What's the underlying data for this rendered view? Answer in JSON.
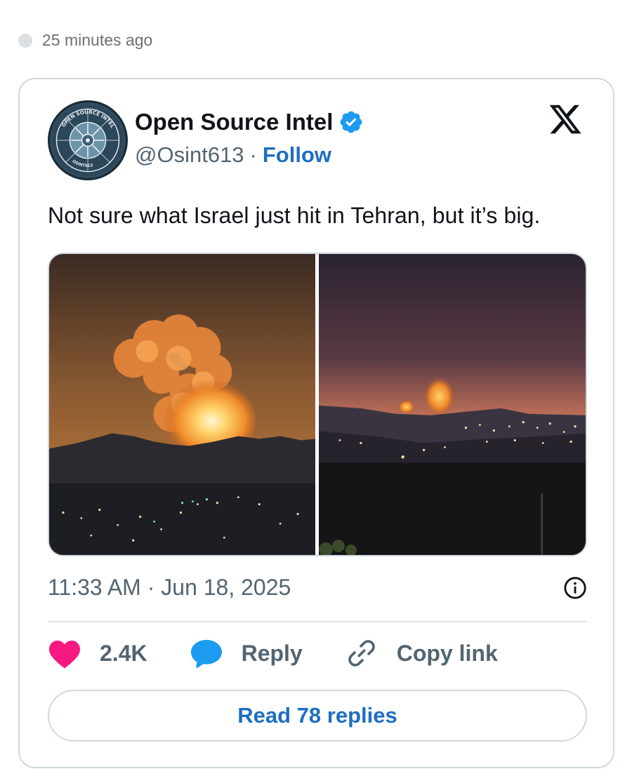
{
  "timestamp": "25 minutes ago",
  "tweet": {
    "display_name": "Open Source Intel",
    "handle": "@Osint613",
    "separator": "·",
    "follow_label": "Follow",
    "text": "Not sure what Israel just hit in Tehran, but it’s big.",
    "time_date": "11:33 AM · Jun 18, 2025",
    "likes": "2.4K",
    "reply_label": "Reply",
    "copy_link_label": "Copy link",
    "read_replies_label": "Read 78 replies"
  },
  "avatar": {
    "ring_text": "OPEN SOURCE INTEL",
    "bottom_text": "OSINT613"
  },
  "colors": {
    "link_blue": "#1d6fbf",
    "verified_blue": "#1d9bf0",
    "like_pink": "#f91880",
    "reply_blue": "#1d9bf0",
    "muted_gray": "#536471",
    "border": "#cfd9de"
  },
  "icons": [
    "verified-badge-icon",
    "x-logo-icon",
    "info-icon",
    "heart-icon",
    "reply-bubble-icon",
    "link-icon"
  ]
}
